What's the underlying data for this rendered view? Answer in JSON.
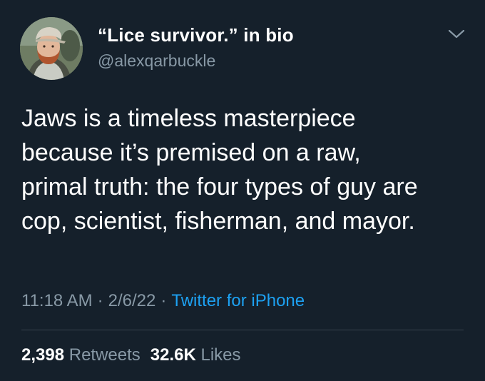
{
  "author": {
    "display_name": "“Lice survivor.” in bio",
    "handle": "@alexqarbuckle",
    "avatar_icon": "profile-photo"
  },
  "menu_icon": "chevron-down-icon",
  "tweet": {
    "lines": [
      "Jaws is a timeless masterpiece",
      "because it’s premised on a raw,",
      "primal truth: the four types of guy are",
      "cop, scientist, fisherman, and mayor."
    ]
  },
  "meta": {
    "time": "11:18 AM",
    "date": "2/6/22",
    "separator": "·",
    "source": "Twitter for iPhone"
  },
  "stats": {
    "retweets_count": "2,398",
    "retweets_label": "Retweets",
    "likes_count": "32.6K",
    "likes_label": "Likes"
  },
  "colors": {
    "background": "#15202b",
    "primary_text": "#ffffff",
    "secondary_text": "#8899a6",
    "link": "#1da1f2",
    "divider": "#38444d"
  }
}
